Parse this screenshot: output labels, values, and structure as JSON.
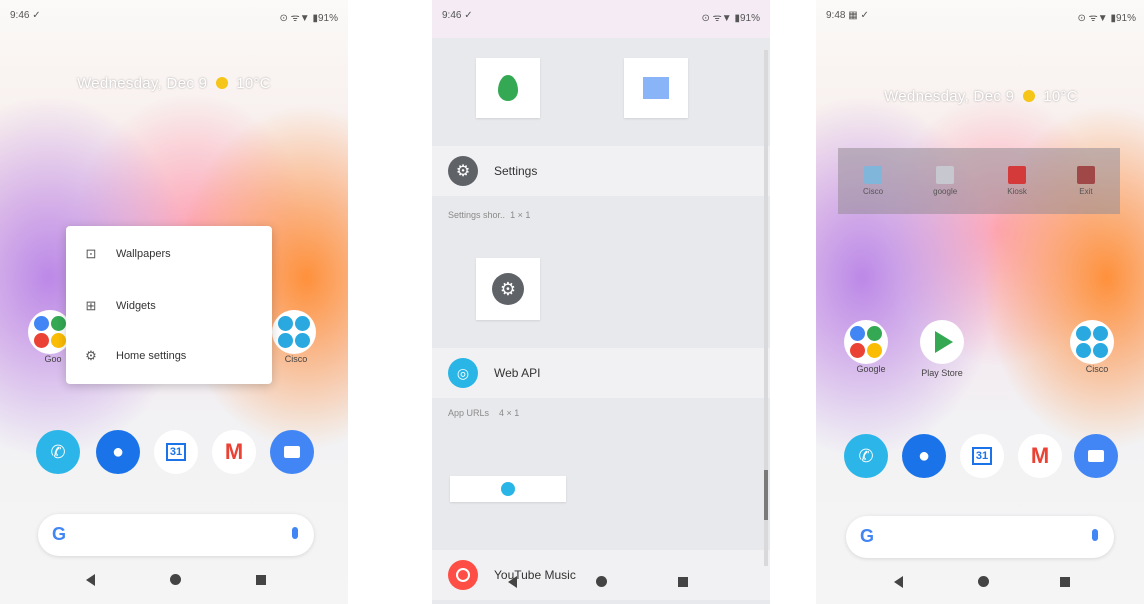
{
  "screen1": {
    "status": {
      "time": "9:46 ✓",
      "right": "⊙ ᯤ▼ ▮91%"
    },
    "date_weather": {
      "text": "Wednesday, Dec 9",
      "temp": "10°C"
    },
    "menu": [
      {
        "label": "Wallpapers",
        "icon": "wallpaper-icon"
      },
      {
        "label": "Widgets",
        "icon": "widgets-icon"
      },
      {
        "label": "Home settings",
        "icon": "gear-icon"
      }
    ],
    "apps": {
      "left_label": "Goo",
      "right_label": "Cisco"
    }
  },
  "screen2": {
    "status": {
      "time": "9:46 ✓",
      "right": "⊙ ᯤ▼ ▮91%"
    },
    "sections": [
      {
        "title": "Settings",
        "subtitle": "Settings shor..",
        "size": "1 × 1"
      },
      {
        "title": "Web API",
        "subtitle": "App URLs",
        "size": "4 × 1"
      },
      {
        "title": "YouTube Music"
      }
    ]
  },
  "screen3": {
    "status": {
      "time": "9:48 ▦ ✓",
      "right": "⊙ ᯤ▼ ▮91%"
    },
    "date_weather": {
      "text": "Wednesday, Dec 9",
      "temp": "10°C"
    },
    "widget_strip": [
      "Cisco",
      "google",
      "Kiosk",
      "Exit"
    ],
    "apps": [
      {
        "label": "Google"
      },
      {
        "label": "Play Store"
      },
      {
        "label": "Cisco"
      }
    ]
  },
  "colors": {
    "accent_blue": "#4285f4",
    "phone_teal": "#2bb5e8",
    "contacts_blue": "#1a73e8",
    "gmail_red": "#ea4335",
    "settings_gray": "#5f6368"
  }
}
